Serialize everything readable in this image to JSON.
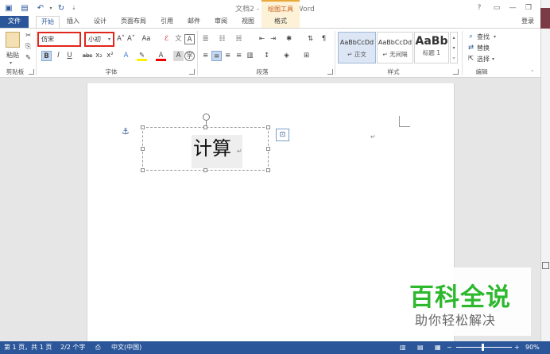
{
  "titlebar": {
    "title": "文档2 - Microsoft Word",
    "contextual_group": "绘图工具",
    "help": "?",
    "login": "登录"
  },
  "tabs": [
    "文件",
    "开始",
    "插入",
    "设计",
    "页面布局",
    "引用",
    "邮件",
    "审阅",
    "视图",
    "格式"
  ],
  "ribbon": {
    "clipboard": {
      "paste": "粘贴",
      "group": "剪贴板"
    },
    "font": {
      "font_name": "仿宋",
      "font_size": "小初",
      "grow": "A˄",
      "shrink": "A˅",
      "change_case": "Aa",
      "bold": "B",
      "italic": "I",
      "underline": "U",
      "strike": "abc",
      "subscript": "x₂",
      "superscript": "x²",
      "group": "字体"
    },
    "paragraph": {
      "group": "段落"
    },
    "styles": {
      "items": [
        {
          "preview": "AaBbCcDd",
          "name": "↵ 正文"
        },
        {
          "preview": "AaBbCcDd",
          "name": "↵ 无间隔"
        },
        {
          "preview": "AaBb",
          "name": "标题 1"
        }
      ],
      "group": "样式"
    },
    "editing": {
      "find": "查找",
      "replace": "替换",
      "select": "选择",
      "group": "编辑"
    }
  },
  "document": {
    "textbox_text": "计算",
    "para_mark": "↵"
  },
  "watermark": {
    "title": "百科全说",
    "subtitle": "助你轻松解决"
  },
  "statusbar": {
    "page": "第 1 页，共 1 页",
    "words": "2/2 个字",
    "lang": "中文(中国)",
    "zoom": "90%",
    "zoom_minus": "−",
    "zoom_plus": "+"
  }
}
